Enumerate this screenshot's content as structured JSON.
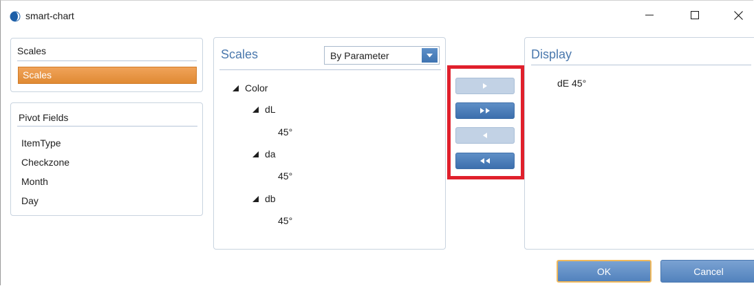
{
  "window": {
    "title": "smart-chart",
    "controls": {
      "minimize": "minimize-icon",
      "maximize": "maximize-icon",
      "close": "close-icon"
    }
  },
  "left_top": {
    "heading": "Scales",
    "selected_item": "Scales"
  },
  "pivot": {
    "heading": "Pivot Fields",
    "items": [
      "ItemType",
      "Checkzone",
      "Month",
      "Day"
    ]
  },
  "middle": {
    "title": "Scales",
    "dropdown": {
      "selected": "By Parameter"
    },
    "tree": [
      {
        "label": "Color",
        "expanded": true
      },
      {
        "label": "dL",
        "expanded": true
      },
      {
        "label": "45°"
      },
      {
        "label": "da",
        "expanded": true
      },
      {
        "label": "45°"
      },
      {
        "label": "db",
        "expanded": true
      },
      {
        "label": "45°"
      }
    ]
  },
  "transfer_buttons": [
    {
      "icon": "move-right-icon",
      "enabled": false
    },
    {
      "icon": "move-all-right-icon",
      "enabled": true
    },
    {
      "icon": "move-left-icon",
      "enabled": false
    },
    {
      "icon": "move-all-left-icon",
      "enabled": true
    }
  ],
  "display": {
    "title": "Display",
    "items": [
      "dE 45°"
    ]
  },
  "footer": {
    "ok_label": "OK",
    "cancel_label": "Cancel"
  },
  "colors": {
    "accent_blue": "#4a78ad",
    "selection_orange": "#e8913a",
    "highlight_red": "#e0202c"
  }
}
